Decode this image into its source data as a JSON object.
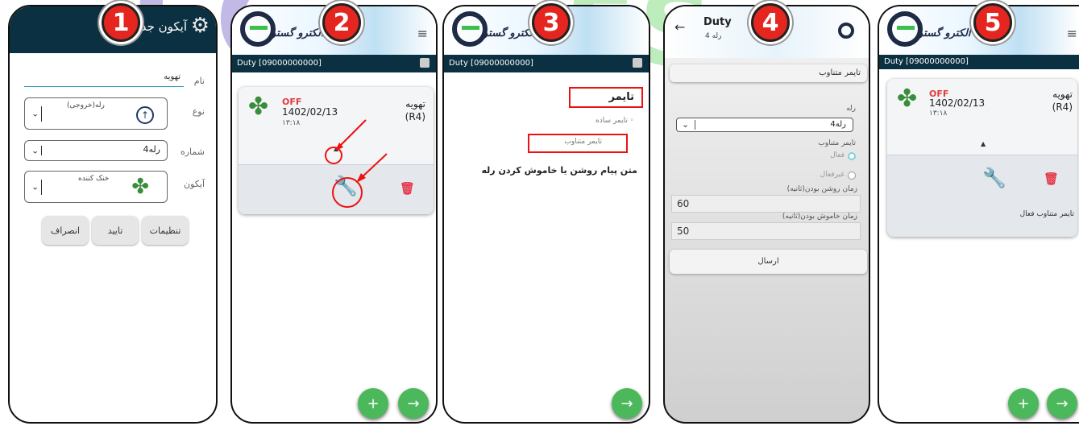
{
  "panel1": {
    "step": "1",
    "title": "آیکون جدید",
    "fields": [
      {
        "label": "نام",
        "value": "تهویه"
      },
      {
        "label": "نوع",
        "value": "رله(خروجی)"
      },
      {
        "label": "شماره",
        "value": "رله4"
      },
      {
        "label": "آیکون",
        "value": "خنک کننده"
      }
    ],
    "buttons": {
      "settings": "تنظیمات",
      "confirm": "تایید",
      "cancel": "انصراف"
    }
  },
  "panel2": {
    "step": "2",
    "brand": "الکترو گستر",
    "duty": "Duty  [09000000000]",
    "card": {
      "status": "OFF",
      "date": "1402/02/13",
      "time": "۱۳:۱۸",
      "name": "تهویه",
      "relay": "(R4)"
    },
    "fab_add": "+",
    "fab_next": "→"
  },
  "panel3": {
    "step": "3",
    "brand": "الکترو گستر",
    "duty": "Duty  [09000000000]",
    "section_title": "تایمر",
    "option_simple": "◦ تایمر ساده",
    "option_periodic": "تایمر متناوب",
    "message_heading": "متن پیام روشن یا خاموش کردن رله",
    "fab_next": "→"
  },
  "panel4": {
    "step": "4",
    "title": "Duty",
    "subtitle": "رله 4",
    "tab": "تایمر متناوب",
    "relay_label": "رله",
    "relay_value": "رله4",
    "timer_label": "تایمر متناوب",
    "active": "فعال",
    "inactive": "غیرفعال",
    "on_time_label": "زمان روشن بودن(ثانیه)",
    "on_time_value": "60",
    "off_time_label": "زمان خاموش بودن(ثانیه)",
    "off_time_value": "50",
    "send": "ارسال"
  },
  "panel5": {
    "step": "5",
    "brand": "الکترو گستر",
    "duty": "Duty  [09000000000]",
    "card": {
      "status": "OFF",
      "date": "1402/02/13",
      "time": "۱۳:۱۸",
      "name": "تهویه",
      "relay": "(R4)"
    },
    "timer_status": "تایمر متناوب فعال",
    "fab_add": "+",
    "fab_next": "→"
  },
  "colors": {
    "header_dark": "#0b3041",
    "badge_red": "#e52620",
    "fab_green": "#4bb85b",
    "off_red": "#e23b3b"
  }
}
